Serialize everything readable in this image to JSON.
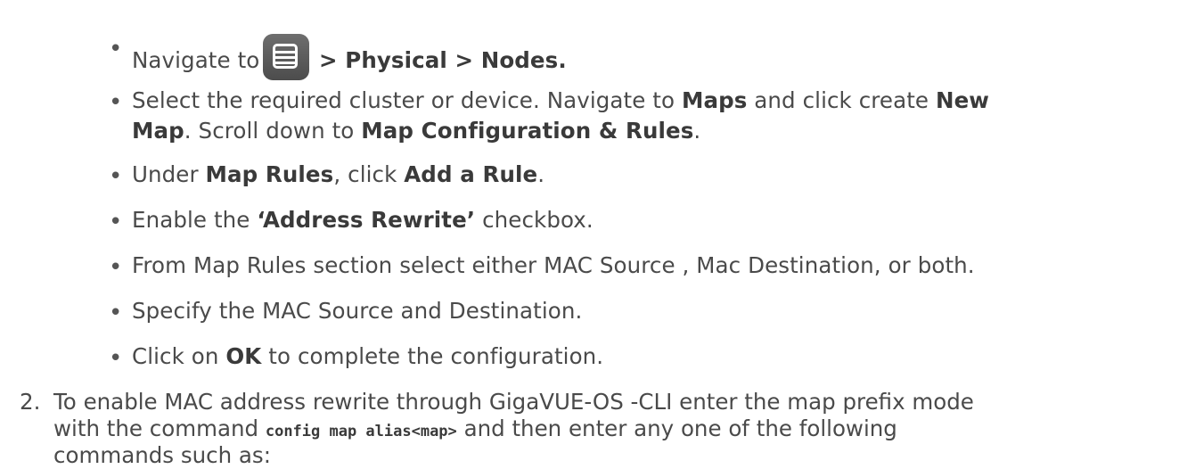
{
  "bullet_char": "•",
  "steps": {
    "b1": {
      "pre": "Navigate to",
      "bold": " > Physical > Nodes."
    },
    "b2": {
      "l1_a": "Select the required cluster or device. Navigate to ",
      "l1_b": "Maps",
      "l1_c": " and click create ",
      "l1_d": "New",
      "l2_a": "Map",
      "l2_b": ". Scroll down to ",
      "l2_c": "Map Configuration & Rules",
      "l2_d": "."
    },
    "b3": {
      "a": "Under ",
      "b": "Map Rules",
      "c": ", click ",
      "d": "Add a Rule",
      "e": "."
    },
    "b4": {
      "a": "Enable the ",
      "b": "‘Address Rewrite’",
      "c": " checkbox."
    },
    "b5": {
      "a": "From Map Rules section select either MAC Source , Mac Destination, or both."
    },
    "b6": {
      "a": "Specify the MAC Source and Destination."
    },
    "b7": {
      "a": "Click on ",
      "b": "OK",
      "c": " to complete the configuration."
    }
  },
  "item2": {
    "number": "2.",
    "l1": "To enable MAC address rewrite through GigaVUE-OS -CLI enter the map prefix mode",
    "l2_a": "with the command ",
    "l2_code": "config map alias<map>",
    "l2_b": " and then enter any one of the following",
    "l3": "commands such as:"
  },
  "icons": {
    "menu": "menu-icon"
  }
}
